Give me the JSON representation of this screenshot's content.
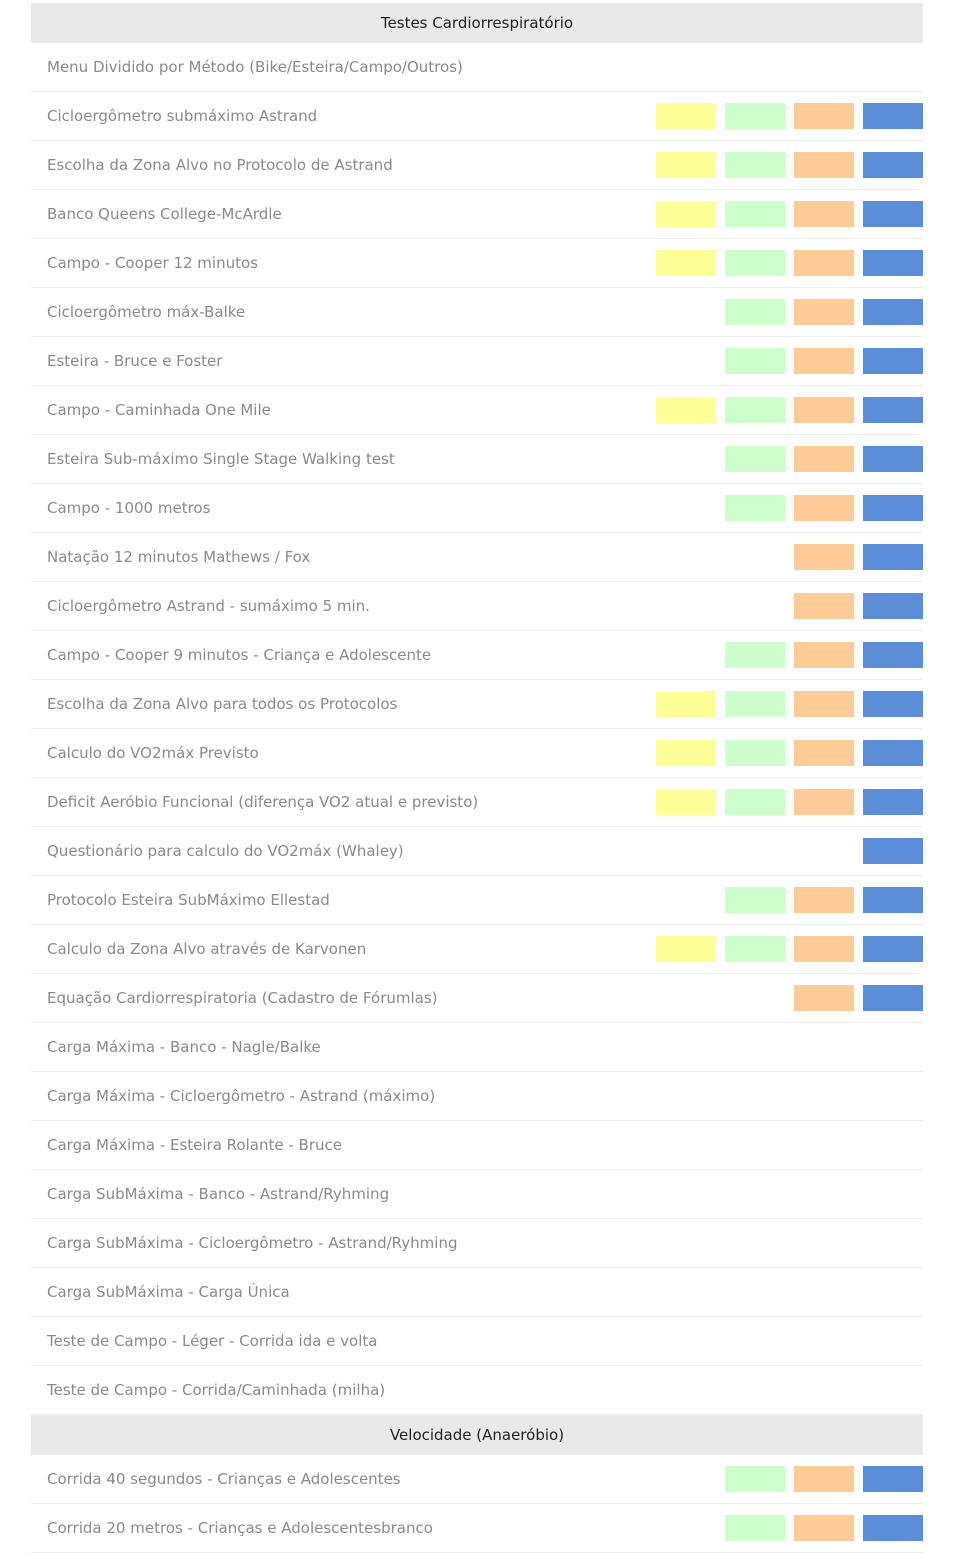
{
  "colors": {
    "yellow": "#ffff99",
    "green": "#ccffcc",
    "orange": "#ffcc99",
    "blue": "#5b8ed6",
    "header_bg": "#e9e9e9",
    "label_text": "#8a8a8a"
  },
  "sections": [
    {
      "title": "Testes Cardiorrespiratório",
      "rows": [
        {
          "label": "Menu Dividido por Método (Bike/Esteira/Campo/Outros)",
          "boxes": [
            false,
            false,
            false,
            false
          ]
        },
        {
          "label": "Cicloergômetro submáximo Astrand",
          "boxes": [
            true,
            true,
            true,
            true
          ]
        },
        {
          "label": "Escolha da Zona Alvo no Protocolo de Astrand",
          "boxes": [
            true,
            true,
            true,
            true
          ]
        },
        {
          "label": "Banco Queens College-McArdle",
          "boxes": [
            true,
            true,
            true,
            true
          ]
        },
        {
          "label": "Campo - Cooper 12 minutos",
          "boxes": [
            true,
            true,
            true,
            true
          ]
        },
        {
          "label": "Cicloergômetro máx-Balke",
          "boxes": [
            false,
            true,
            true,
            true
          ]
        },
        {
          "label": "Esteira - Bruce e Foster",
          "boxes": [
            false,
            true,
            true,
            true
          ]
        },
        {
          "label": "Campo - Caminhada One Mile",
          "boxes": [
            true,
            true,
            true,
            true
          ]
        },
        {
          "label": "Esteira Sub-máximo Single Stage Walking test",
          "boxes": [
            false,
            true,
            true,
            true
          ]
        },
        {
          "label": "Campo - 1000 metros",
          "boxes": [
            false,
            true,
            true,
            true
          ]
        },
        {
          "label": "Natação 12 minutos Mathews / Fox",
          "boxes": [
            false,
            false,
            true,
            true
          ]
        },
        {
          "label": "Cicloergômetro Astrand - sumáximo 5 min.",
          "boxes": [
            false,
            false,
            true,
            true
          ]
        },
        {
          "label": "Campo - Cooper 9 minutos - Criança e Adolescente",
          "boxes": [
            false,
            true,
            true,
            true
          ]
        },
        {
          "label": "Escolha da Zona Alvo para todos os Protocolos",
          "boxes": [
            true,
            true,
            true,
            true
          ]
        },
        {
          "label": "Calculo do VO2máx Previsto",
          "boxes": [
            true,
            true,
            true,
            true
          ]
        },
        {
          "label": "Deficit Aeróbio Funcional (diferença VO2 atual e previsto)",
          "boxes": [
            true,
            true,
            true,
            true
          ]
        },
        {
          "label": "Questionário para calculo do VO2máx (Whaley)",
          "boxes": [
            false,
            false,
            false,
            true
          ]
        },
        {
          "label": "Protocolo Esteira SubMáximo Ellestad",
          "boxes": [
            false,
            true,
            true,
            true
          ]
        },
        {
          "label": "Calculo da Zona Alvo através de Karvonen",
          "boxes": [
            true,
            true,
            true,
            true
          ]
        },
        {
          "label": "Equação Cardiorrespiratoria (Cadastro de Fórumlas)",
          "boxes": [
            false,
            false,
            true,
            true
          ]
        },
        {
          "label": "Carga Máxima - Banco - Nagle/Balke",
          "boxes": [
            false,
            false,
            false,
            false
          ]
        },
        {
          "label": "Carga Máxima - Cicloergômetro - Astrand (máximo)",
          "boxes": [
            false,
            false,
            false,
            false
          ]
        },
        {
          "label": "Carga Máxima - Esteira Rolante - Bruce",
          "boxes": [
            false,
            false,
            false,
            false
          ]
        },
        {
          "label": "Carga SubMáxima - Banco - Astrand/Ryhming",
          "boxes": [
            false,
            false,
            false,
            false
          ]
        },
        {
          "label": "Carga SubMáxima - Cicloergômetro - Astrand/Ryhming",
          "boxes": [
            false,
            false,
            false,
            false
          ]
        },
        {
          "label": "Carga SubMáxima - Carga Única",
          "boxes": [
            false,
            false,
            false,
            false
          ]
        },
        {
          "label": "Teste de Campo - Léger - Corrida ida e volta",
          "boxes": [
            false,
            false,
            false,
            false
          ]
        },
        {
          "label": "Teste de Campo - Corrida/Caminhada (milha)",
          "boxes": [
            false,
            false,
            false,
            false
          ]
        }
      ]
    },
    {
      "title": "Velocidade (Anaeróbio)",
      "rows": [
        {
          "label": "Corrida 40 segundos - Crianças e Adolescentes",
          "boxes": [
            false,
            true,
            true,
            true
          ]
        },
        {
          "label": "Corrida 20 metros - Crianças e Adolescentesbranco",
          "boxes": [
            false,
            true,
            true,
            true
          ]
        }
      ]
    }
  ]
}
